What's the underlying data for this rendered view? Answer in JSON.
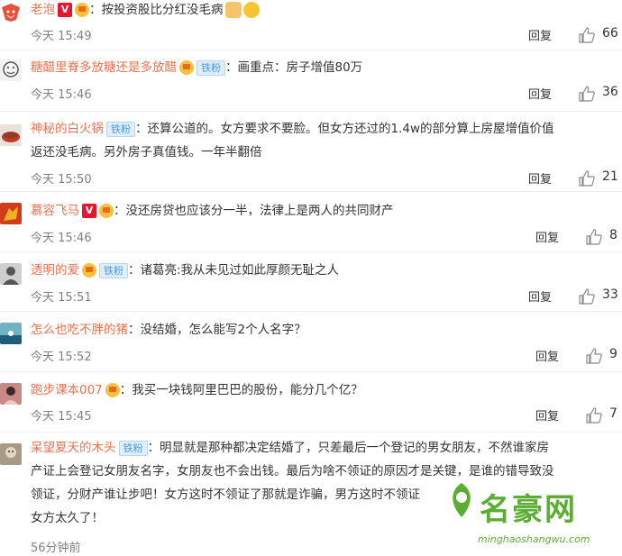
{
  "reply_label": "回复",
  "icons": {
    "like": "thumb-up-icon",
    "crown": "crown-icon",
    "verified": "v-icon"
  },
  "comments": [
    {
      "user": "老泡",
      "text": "按投资股比分红没毛病",
      "time": "今天 15:49",
      "likes": "66",
      "badge_v": "V"
    },
    {
      "user": "糖醋里脊多放糖还是多放醋",
      "fan": "铁粉",
      "text": "画重点：房子增值80万",
      "time": "今天 15:46",
      "likes": "36"
    },
    {
      "user": "神秘的白火锅",
      "fan": "铁粉",
      "text_line1": "还算公道的。女方要求不要脸。但女方还过的1.4w的部分算上房屋增值价值",
      "text_line2": "返还没毛病。另外房子真值钱。一年半翻倍",
      "time": "今天 15:50",
      "likes": "21"
    },
    {
      "user": "慕容飞马",
      "text": "没还房贷也应该分一半，法律上是两人的共同财产",
      "time": "今天 15:46",
      "likes": "8",
      "badge_v": "V"
    },
    {
      "user": "透明的爱",
      "fan": "铁粉",
      "text": "诸葛亮:我从未见过如此厚颜无耻之人",
      "time": "今天 15:51",
      "likes": "33"
    },
    {
      "user": "怎么也吃不胖的猪",
      "text": "没结婚，怎么能写2个人名字？",
      "time": "今天 15:52",
      "likes": "9"
    },
    {
      "user": "跑步课本007",
      "text": "我买一块钱阿里巴巴的股份，能分几个亿？",
      "time": "今天 15:45",
      "likes": "7"
    },
    {
      "user": "呆望夏天的木头",
      "fan": "铁粉",
      "text_line1": "明显就是那种都决定结婚了，只差最后一个登记的男女朋友，不然谁家房",
      "text_line2": "产证上会登记女朋友名字，女朋友也不会出钱。最后为啥不领证的原因才是关键，是谁的错导致没",
      "text_line3": "领证，分财产谁让步吧！女方这时不领证了那就是诈骗，男方这时不领证",
      "text_line4": "女方太久了！",
      "time": "56分钟前"
    }
  ],
  "watermark": {
    "brand": "名豪网",
    "url": "minghaoshangwu.com"
  }
}
